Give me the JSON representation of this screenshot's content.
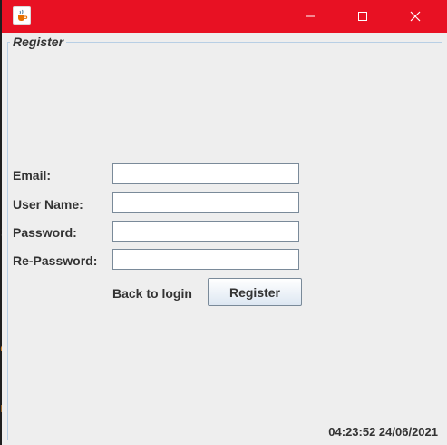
{
  "window": {
    "title": "",
    "icon": "java-cup-icon",
    "controls": [
      "minimize-icon",
      "maximize-icon",
      "close-icon"
    ],
    "accent_color": "#e81123"
  },
  "panel": {
    "title": "Register"
  },
  "form": {
    "email_label": "Email:",
    "username_label": "User Name:",
    "password_label": "Password:",
    "repassword_label": "Re-Password:",
    "email_value": "",
    "username_value": "",
    "password_value": "",
    "repassword_value": ""
  },
  "actions": {
    "back_label": "Back to login",
    "register_label": "Register"
  },
  "status": {
    "clock": "04:23:52 24/06/2021"
  }
}
